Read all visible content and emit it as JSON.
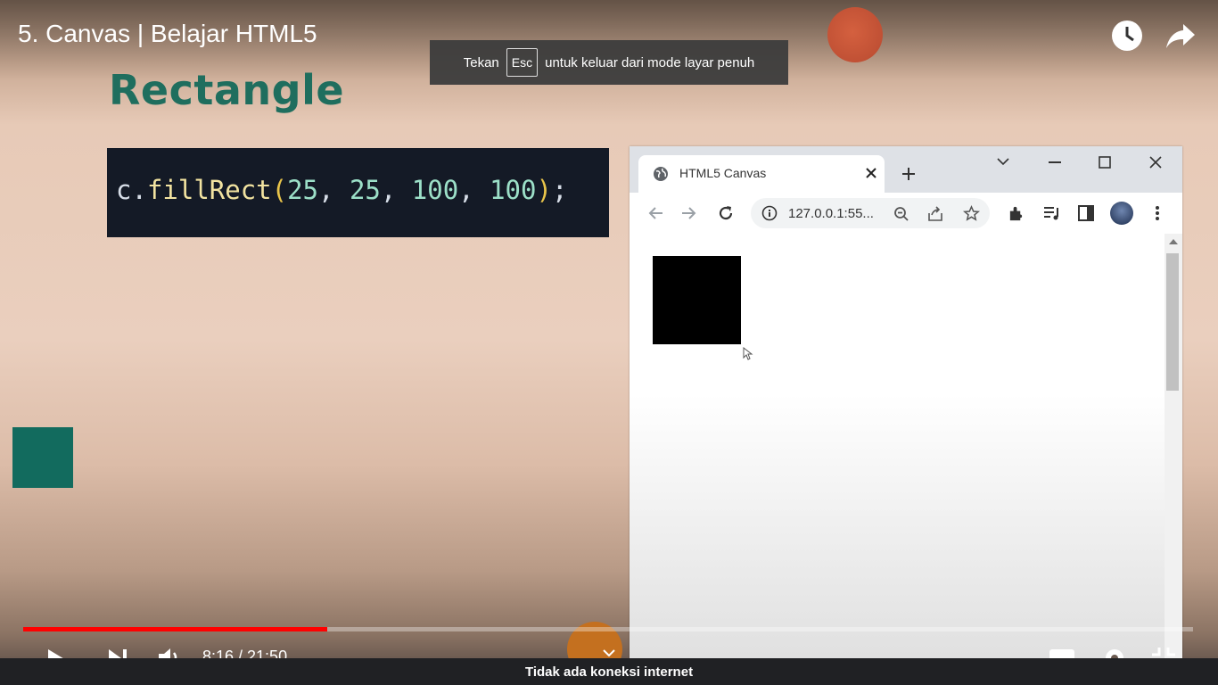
{
  "player": {
    "title": "5. Canvas | Belajar HTML5",
    "time": "8:16 / 21:50",
    "progress_fraction": 0.26,
    "icons": [
      "clock-icon",
      "share-icon",
      "play-icon",
      "next-icon",
      "volume-icon",
      "settings-icon"
    ]
  },
  "toast": {
    "prefix": "Tekan",
    "key": "Esc",
    "suffix": "untuk keluar dari mode layar penuh"
  },
  "slide": {
    "heading": "Rectangle",
    "code": {
      "obj": "c",
      "dot": ".",
      "method": "fillRect",
      "open": "(",
      "args": [
        "25",
        "25",
        "100",
        "100"
      ],
      "close": ")",
      "semi": ";"
    },
    "colors": {
      "heading": "#1f6e5e",
      "code_bg": "#141a26",
      "teal_square": "#126b5e"
    }
  },
  "browser": {
    "tab_title": "HTML5 Canvas",
    "url": "127.0.0.1:55...",
    "canvas_rect_fill": "#000000"
  },
  "status": {
    "message": "Tidak ada koneksi internet"
  }
}
